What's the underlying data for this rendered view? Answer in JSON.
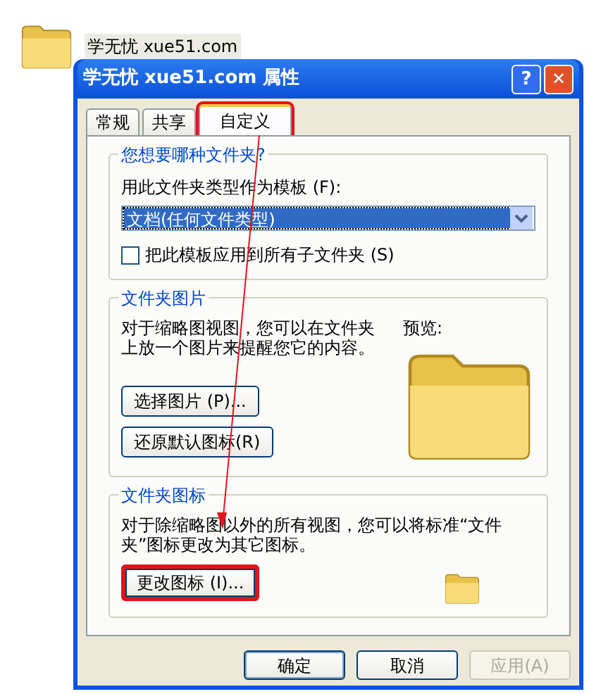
{
  "desktop_icon": {
    "label": "学无忧 xue51.com"
  },
  "window": {
    "title": "学无忧 xue51.com 属性",
    "help": "?",
    "close": "✕"
  },
  "tabs": [
    {
      "label": "常规",
      "selected": false,
      "highlighted": false
    },
    {
      "label": "共享",
      "selected": false,
      "highlighted": false
    },
    {
      "label": "自定义",
      "selected": true,
      "highlighted": true
    }
  ],
  "folder_type": {
    "heading": "您想要哪种文件夹?",
    "label": "用此文件夹类型作为模板 (F):",
    "value": "文档(任何文件类型)",
    "subfolders": {
      "label": "把此模板应用到所有子文件夹 (S)",
      "checked": false
    }
  },
  "folder_picture": {
    "heading": "文件夹图片",
    "description": "对于缩略图视图，您可以在文件夹上放一个图片来提醒您它的内容。",
    "preview_label": "预览:",
    "buttons": [
      {
        "label": "选择图片 (P)...",
        "highlighted": false
      },
      {
        "label": "还原默认图标(R)",
        "highlighted": false
      }
    ]
  },
  "folder_icon": {
    "heading": "文件夹图标",
    "description": "对于除缩略图以外的所有视图，您可以将标准“文件夹”图标更改为其它图标。",
    "button": {
      "label": "更改图标 (I)...",
      "highlighted": true
    }
  },
  "annotation": {
    "arrow": true
  },
  "buttons": [
    {
      "label": "确定",
      "disabled": false,
      "default": true
    },
    {
      "label": "取消",
      "disabled": false,
      "default": false
    },
    {
      "label": "应用(A)",
      "disabled": true,
      "default": false
    }
  ]
}
